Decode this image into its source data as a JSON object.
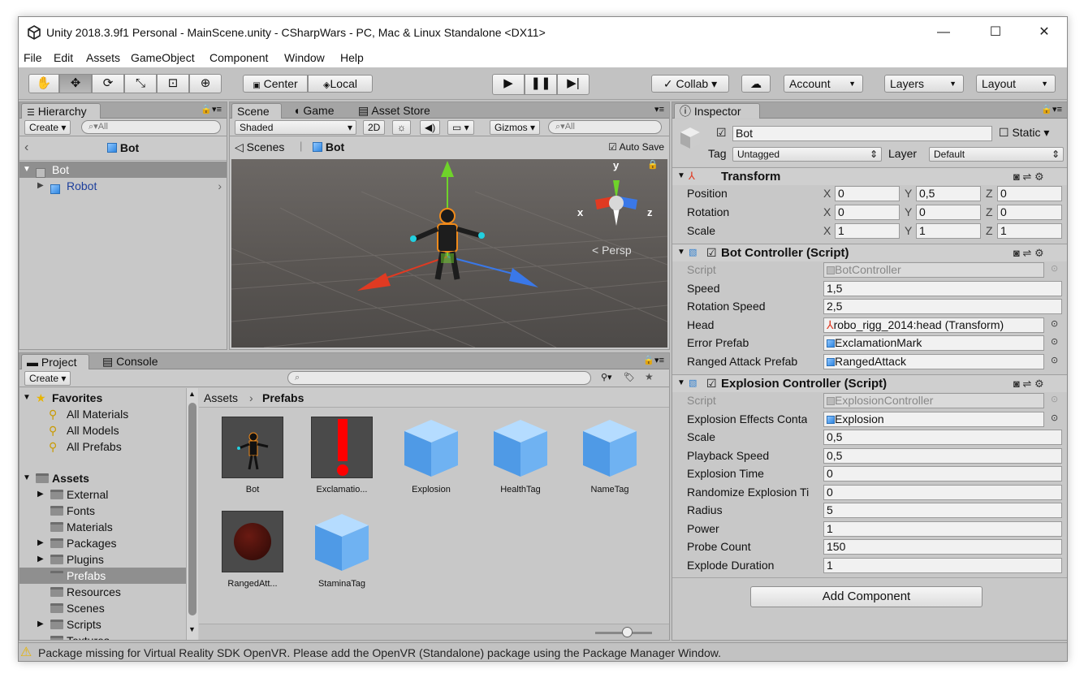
{
  "window": {
    "title": "Unity 2018.3.9f1 Personal - MainScene.unity - CSharpWars - PC, Mac & Linux Standalone <DX11>",
    "minimize": "—",
    "maximize": "☐",
    "close": "✕"
  },
  "menu": [
    "File",
    "Edit",
    "Assets",
    "GameObject",
    "Component",
    "Window",
    "Help"
  ],
  "toolbar": {
    "tools": [
      "hand-tool-icon",
      "move-tool-icon",
      "rotate-tool-icon",
      "scale-tool-icon",
      "rect-tool-icon",
      "transform-tool-icon"
    ],
    "pivot": "Center",
    "space": "Local",
    "collab": "Collab ▾",
    "account": "Account",
    "layers": "Layers",
    "layout": "Layout"
  },
  "hierarchy": {
    "tab": "Hierarchy",
    "create": "Create",
    "search_placeholder": "All",
    "breadcrumb": "Bot",
    "items": [
      {
        "label": "Bot",
        "selected": true
      },
      {
        "label": "Robot",
        "selected": false
      }
    ]
  },
  "scene": {
    "tabs": [
      "Scene",
      "Game",
      "Asset Store"
    ],
    "shading": "Shaded",
    "mode_2d": "2D",
    "gizmos": "Gizmos",
    "search_placeholder": "All",
    "crumb_scenes": "Scenes",
    "crumb_object": "Bot",
    "auto_save": "Auto Save",
    "persp": "Persp",
    "axes": {
      "x": "x",
      "y": "y",
      "z": "z"
    }
  },
  "project": {
    "tabs": [
      "Project",
      "Console"
    ],
    "create": "Create",
    "favorites_label": "Favorites",
    "favorites": [
      "All Materials",
      "All Models",
      "All Prefabs"
    ],
    "assets_label": "Assets",
    "folders": [
      {
        "label": "External",
        "arrow": true,
        "selected": false
      },
      {
        "label": "Fonts",
        "arrow": false,
        "selected": false
      },
      {
        "label": "Materials",
        "arrow": false,
        "selected": false
      },
      {
        "label": "Packages",
        "arrow": true,
        "selected": false
      },
      {
        "label": "Plugins",
        "arrow": true,
        "selected": false
      },
      {
        "label": "Prefabs",
        "arrow": false,
        "selected": true
      },
      {
        "label": "Resources",
        "arrow": false,
        "selected": false
      },
      {
        "label": "Scenes",
        "arrow": false,
        "selected": false
      },
      {
        "label": "Scripts",
        "arrow": true,
        "selected": false
      },
      {
        "label": "Textures",
        "arrow": false,
        "selected": false
      }
    ],
    "path_root": "Assets",
    "path_current": "Prefabs",
    "assets": [
      "Bot",
      "Exclamatio...",
      "Explosion",
      "HealthTag",
      "NameTag",
      "RangedAtt...",
      "StaminaTag"
    ]
  },
  "inspector": {
    "tab": "Inspector",
    "object_name": "Bot",
    "static_label": "Static",
    "tag_label": "Tag",
    "tag_value": "Untagged",
    "layer_label": "Layer",
    "layer_value": "Default",
    "transform": {
      "title": "Transform",
      "rows": [
        {
          "label": "Position",
          "x": "0",
          "y": "0,5",
          "z": "0"
        },
        {
          "label": "Rotation",
          "x": "0",
          "y": "0",
          "z": "0"
        },
        {
          "label": "Scale",
          "x": "1",
          "y": "1",
          "z": "1"
        }
      ]
    },
    "bot_controller": {
      "title": "Bot Controller (Script)",
      "rows": [
        {
          "label": "Script",
          "value": "BotController",
          "kind": "disabled"
        },
        {
          "label": "Speed",
          "value": "1,5",
          "kind": "text"
        },
        {
          "label": "Rotation Speed",
          "value": "2,5",
          "kind": "text"
        },
        {
          "label": "Head",
          "value": "robo_rigg_2014:head (Transform)",
          "kind": "object"
        },
        {
          "label": "Error Prefab",
          "value": "ExclamationMark",
          "kind": "object"
        },
        {
          "label": "Ranged Attack Prefab",
          "value": "RangedAttack",
          "kind": "object"
        }
      ]
    },
    "explosion_controller": {
      "title": "Explosion Controller (Script)",
      "rows": [
        {
          "label": "Script",
          "value": "ExplosionController",
          "kind": "disabled"
        },
        {
          "label": "Explosion Effects Conta",
          "value": "Explosion",
          "kind": "object"
        },
        {
          "label": "Scale",
          "value": "0,5",
          "kind": "text"
        },
        {
          "label": "Playback Speed",
          "value": "0,5",
          "kind": "text"
        },
        {
          "label": "Explosion Time",
          "value": "0",
          "kind": "text"
        },
        {
          "label": "Randomize Explosion Ti",
          "value": "0",
          "kind": "text"
        },
        {
          "label": "Radius",
          "value": "5",
          "kind": "text"
        },
        {
          "label": "Power",
          "value": "1",
          "kind": "text"
        },
        {
          "label": "Probe Count",
          "value": "150",
          "kind": "text"
        },
        {
          "label": "Explode Duration",
          "value": "1",
          "kind": "text"
        }
      ]
    },
    "add_component": "Add Component"
  },
  "status": {
    "message": "Package missing for Virtual Reality SDK OpenVR. Please add the OpenVR (Standalone) package using the Package Manager Window."
  },
  "colors": {
    "selection": "#8f8f8f",
    "scene_bg": "#5c5855",
    "axis_x": "#e03a22",
    "axis_y": "#6fd32a",
    "axis_z": "#3a78e8"
  }
}
